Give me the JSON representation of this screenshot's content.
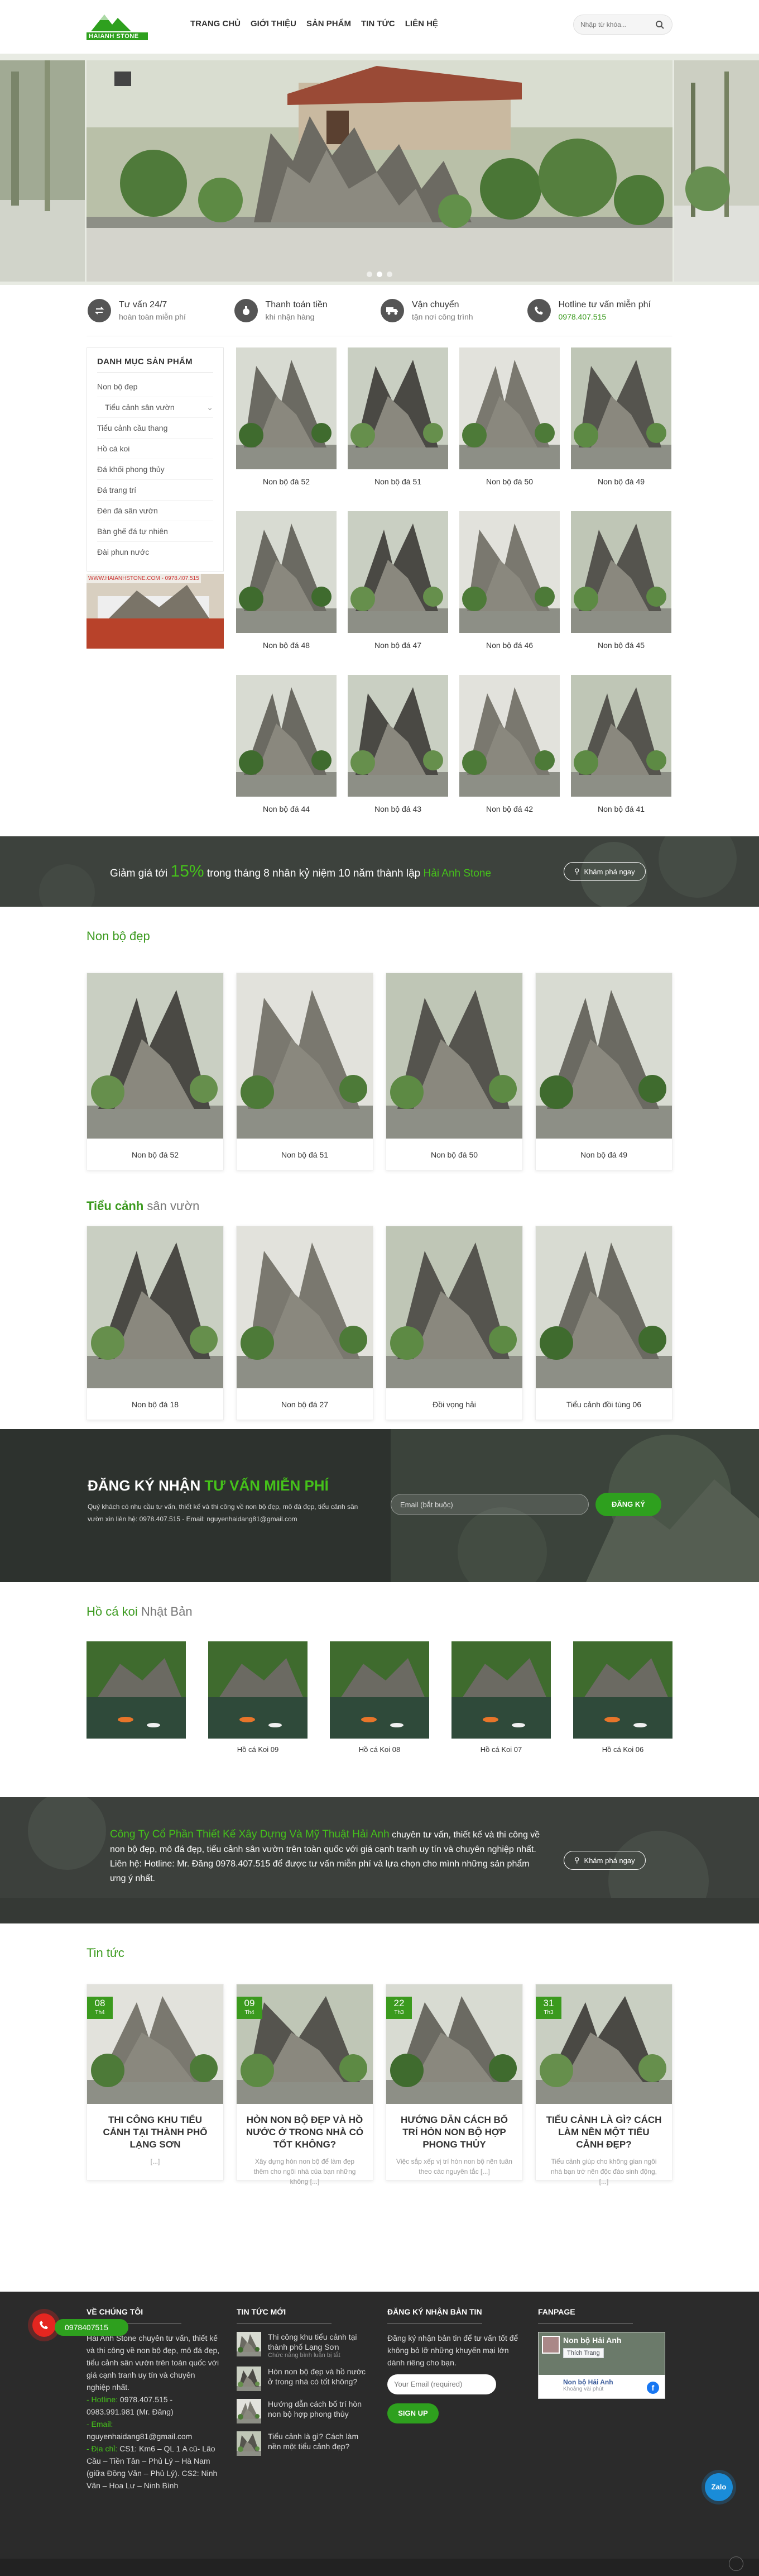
{
  "brand": {
    "logo_text": "HAIANH STONE",
    "accent": "#3b9a1e",
    "accent_bright": "#45c21a"
  },
  "nav": {
    "items": [
      "TRANG CHỦ",
      "GIỚI THIỆU",
      "SẢN PHẨM",
      "TIN TỨC",
      "LIÊN HỆ"
    ]
  },
  "search": {
    "placeholder": "Nhập từ khóa..."
  },
  "features": [
    {
      "icon": "exchange-icon",
      "title": "Tư vấn 24/7",
      "sub": "hoàn toàn miễn phí"
    },
    {
      "icon": "money-icon",
      "title": "Thanh toán tiền",
      "sub": "khi nhận hàng"
    },
    {
      "icon": "truck-icon",
      "title": "Vận chuyển",
      "sub": "tận nơi công trình"
    },
    {
      "icon": "phone-icon",
      "title": "Hotline tư vấn miễn phí",
      "sub": "0978.407.515"
    }
  ],
  "sidebar": {
    "title": "DANH MỤC SẢN PHẨM",
    "items": [
      "Non bộ đẹp",
      "Tiểu cảnh sân vườn",
      "Tiểu cảnh cầu thang",
      "Hồ cá koi",
      "Đá khối phong thủy",
      "Đá trang trí",
      "Đèn đá sân vườn",
      "Bàn ghế đá tự nhiên",
      "Đài phun nước"
    ],
    "ad_text": "WWW.HAIANHSTONE.COM - 0978.407.515"
  },
  "products": [
    "Non bộ đá 52",
    "Non bộ đá 51",
    "Non bộ đá 50",
    "Non bộ đá 49",
    "Non bộ đá 48",
    "Non bộ đá 47",
    "Non bộ đá 46",
    "Non bộ đá 45",
    "Non bộ đá 44",
    "Non bộ đá 43",
    "Non bộ đá 42",
    "Non bộ đá 41"
  ],
  "promo": {
    "prefix": "Giảm giá tới ",
    "percent": "15%",
    "middle": " trong tháng 8 nhân kỷ niệm 10 năm thành lập ",
    "brand": "Hải Anh Stone",
    "button": "Khám phá ngay"
  },
  "section_nonbo": {
    "title": "Non bộ đẹp",
    "items": [
      "Non bộ đá 52",
      "Non bộ đá 51",
      "Non bộ đá 50",
      "Non bộ đá 49"
    ]
  },
  "section_tieucanh": {
    "title_bold": "Tiểu cảnh",
    "title_rest": " sân vườn",
    "items": [
      "Non bộ đá 18",
      "Non bộ đá 27",
      "Đồi vọng hải",
      "Tiểu cảnh đồi tùng 06"
    ]
  },
  "register": {
    "title_white": "ĐĂNG KÝ NHẬN ",
    "title_green": "TƯ VẤN MIỄN PHÍ",
    "desc": "Quý khách có nhu cầu tư vấn, thiết kế và thi công về non bộ đẹp, mô đá đẹp, tiểu cảnh sân vườn xin liên hệ: 0978.407.515 - Email: nguyenhaidang81@gmail.com",
    "placeholder": "Email (bắt buộc)",
    "button": "ĐĂNG KÝ"
  },
  "section_koi": {
    "title_green": "Hồ cá koi",
    "title_grey": " Nhật Bản",
    "items": [
      "",
      "Hồ cá Koi 09",
      "Hồ cá Koi 08",
      "Hồ cá Koi 07",
      "Hồ cá Koi 06"
    ]
  },
  "company": {
    "name": "Công Ty Cổ Phần Thiết Kế Xây Dựng Và Mỹ Thuật Hải Anh",
    "text": " chuyên tư vấn, thiết kế và thi công về non bộ đẹp, mô đá đẹp, tiểu cảnh sân vườn trên toàn quốc với giá cạnh tranh uy tín và chuyên nghiệp nhất. Liên hệ: Hotline: Mr. Đăng 0978.407.515 để được tư vấn miễn phí và lựa chọn cho mình những sản phẩm ưng ý nhất.",
    "button": "Khám phá ngay"
  },
  "news": {
    "title": "Tin tức",
    "items": [
      {
        "day": "08",
        "month": "Th4",
        "title": "THI CÔNG KHU TIỂU CẢNH TẠI THÀNH PHỐ LẠNG SƠN",
        "excerpt": "[...]"
      },
      {
        "day": "09",
        "month": "Th4",
        "title": "HÒN NON BỘ ĐẸP VÀ HỒ NƯỚC Ở TRONG NHÀ CÓ TỐT KHÔNG?",
        "excerpt": "Xây dựng hòn non bộ để làm đẹp thêm cho ngôi nhà của bạn những không [...]"
      },
      {
        "day": "22",
        "month": "Th3",
        "title": "HƯỚNG DẪN CÁCH BỐ TRÍ HÒN NON BỘ HỢP PHONG THỦY",
        "excerpt": "Việc sắp xếp vị trí hòn non bộ nên tuân theo các nguyên tắc [...]"
      },
      {
        "day": "31",
        "month": "Th3",
        "title": "TIỂU CẢNH LÀ GÌ? CÁCH LÀM NỀN MỘT TIỂU CẢNH ĐẸP?",
        "excerpt": "Tiểu cảnh giúp cho không gian ngôi nhà bạn trở nên độc đáo sinh động, [...]"
      }
    ]
  },
  "footer": {
    "about_title": "VỀ CHÚNG TÔI",
    "about_text": "Hải Anh Stone chuyên tư vấn, thiết kế và thi công về non bộ đẹp, mô đá đẹp, tiểu cảnh sân vườn trên toàn quốc với giá cạnh tranh uy tín và chuyên nghiệp nhất.",
    "hotline_label": "- Hotline:",
    "hotline": " 0978.407.515 - 0983.991.981 (Mr. Đăng)",
    "email_label": "- Email:",
    "email": " nguyenhaidang81@gmail.com",
    "address_label": "- Địa chỉ:",
    "address": " CS1: Km6 – QL 1 A cũ- Lão Cầu – Tiền Tân – Phủ Lý – Hà Nam (giữa Đồng Văn – Phủ Lý). CS2: Ninh Vân – Hoa Lư – Ninh Bình",
    "news_title": "TIN TỨC MỚI",
    "news": [
      {
        "title": "Thi công khu tiểu cảnh tại thành phố Lạng Sơn",
        "sub": "Chức năng bình luận bị tắt"
      },
      {
        "title": "Hòn non bộ đẹp và hồ nước ở trong nhà có tốt không?",
        "sub": ""
      },
      {
        "title": "Hướng dẫn cách bố trí hòn non bộ hợp phong thủy",
        "sub": ""
      },
      {
        "title": "Tiểu cảnh là gì? Cách làm nền một tiểu cảnh đẹp?",
        "sub": ""
      }
    ],
    "sub_title": "ĐĂNG KÝ NHẬN BẢN TIN",
    "sub_text": "Đăng ký nhận bản tin để tư vấn tốt để không bỏ lỡ những khuyến mại lớn dành riêng cho bạn.",
    "sub_placeholder": "Your Email (required)",
    "sub_button": "SIGN UP",
    "fan_title": "FANPAGE",
    "fb_name": "Non bộ Hải Anh",
    "fb_like": "Thích Trang",
    "fb_name2": "Non bộ Hải Anh",
    "fb_sub": "Khoảng vài phút"
  },
  "floating": {
    "phone": "0978407515",
    "zalo": "Zalo"
  }
}
